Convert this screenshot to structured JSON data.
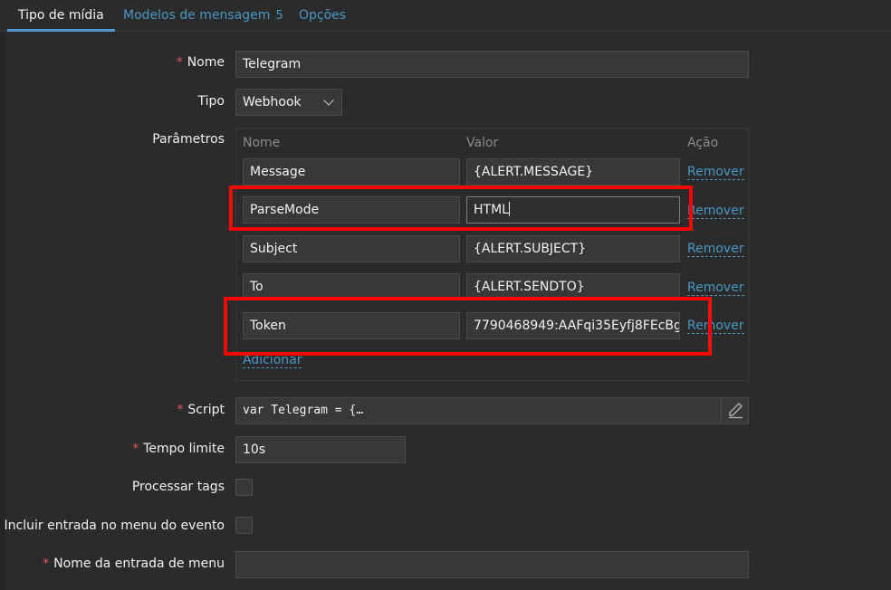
{
  "tabs": [
    {
      "label": "Tipo de mídia",
      "active": true
    },
    {
      "label": "Modelos de mensagem",
      "count": "5"
    },
    {
      "label": "Opções"
    }
  ],
  "form": {
    "nome_label": "Nome",
    "nome_value": "Telegram",
    "tipo_label": "Tipo",
    "tipo_value": "Webhook",
    "parametros_label": "Parâmetros",
    "params_headers": {
      "nome": "Nome",
      "valor": "Valor",
      "acao": "Ação"
    },
    "params": [
      {
        "name": "Message",
        "value": "{ALERT.MESSAGE}",
        "action": "Remover"
      },
      {
        "name": "ParseMode",
        "value": "HTML",
        "action": "Remover"
      },
      {
        "name": "Subject",
        "value": "{ALERT.SUBJECT}",
        "action": "Remover"
      },
      {
        "name": "To",
        "value": "{ALERT.SENDTO}",
        "action": "Remover"
      },
      {
        "name": "Token",
        "value": "7790468949:AAFqi35Eyfj8FEcBg",
        "action": "Remover"
      }
    ],
    "add_label": "Adicionar",
    "script_label": "Script",
    "script_value": "var Telegram = {…",
    "timeout_label": "Tempo limite",
    "timeout_value": "10s",
    "process_tags_label": "Processar tags",
    "include_menu_label": "Incluir entrada no menu do evento",
    "menu_name_label": "Nome da entrada de menu",
    "menu_name_value": ""
  },
  "colors": {
    "accent": "#4796c4",
    "required": "#e45959",
    "highlight": "#ff0000"
  },
  "icons": {
    "tipo_dropdown": "chevron-down-icon",
    "script_edit": "pencil-icon"
  }
}
